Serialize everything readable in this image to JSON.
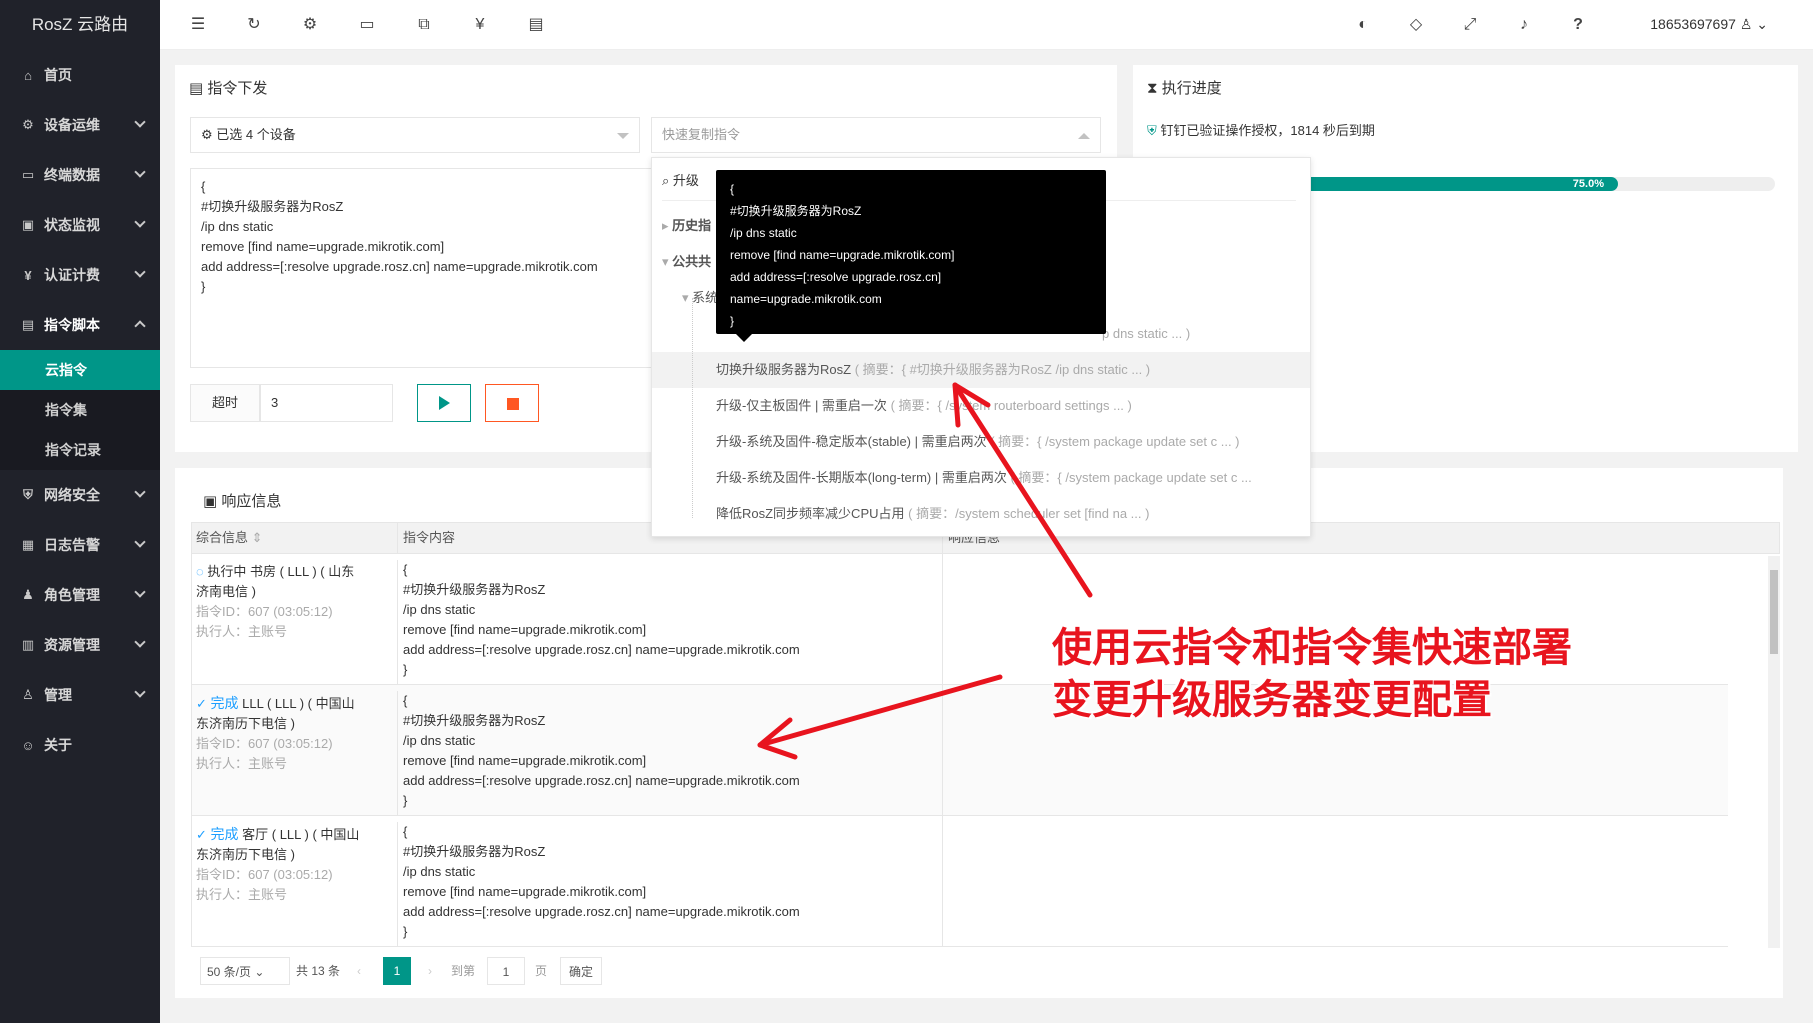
{
  "app": {
    "logo": "RosZ 云路由",
    "user": "18653697697"
  },
  "sidebar": {
    "items": [
      {
        "label": "首页",
        "icon": "home-icon"
      },
      {
        "label": "设备运维",
        "icon": "device-icon"
      },
      {
        "label": "终端数据",
        "icon": "terminal-icon"
      },
      {
        "label": "状态监视",
        "icon": "monitor-icon"
      },
      {
        "label": "认证计费",
        "icon": "billing-icon"
      },
      {
        "label": "指令脚本",
        "icon": "script-icon"
      },
      {
        "label": "网络安全",
        "icon": "shield-icon"
      },
      {
        "label": "日志告警",
        "icon": "log-icon"
      },
      {
        "label": "角色管理",
        "icon": "role-icon"
      },
      {
        "label": "资源管理",
        "icon": "resource-icon"
      },
      {
        "label": "管理",
        "icon": "admin-icon"
      },
      {
        "label": "关于",
        "icon": "about-icon"
      }
    ],
    "sub": [
      "云指令",
      "指令集",
      "指令记录"
    ]
  },
  "command": {
    "title": "指令下发",
    "device_select": "已选 4 个设备",
    "quick_placeholder": "快速复制指令",
    "script": "{\n#切换升级服务器为RosZ\n/ip dns static\nremove [find name=upgrade.mikrotik.com]\nadd address=[:resolve upgrade.rosz.cn] name=upgrade.mikrotik.com\n}",
    "timeout_label": "超时",
    "timeout_value": "3"
  },
  "dropdown": {
    "search_value": "升级",
    "group_history": "历史指",
    "group_public": "公共共",
    "group_sys": "系统",
    "first_partial": "p dns static ... )",
    "items": [
      {
        "name": "切换升级服务器为RosZ",
        "sum": "( 摘要：{ #切换升级服务器为RosZ /ip dns static ... )"
      },
      {
        "name": "升级-仅主板固件 | 需重启一次",
        "sum": "( 摘要：{ /system routerboard settings ... )"
      },
      {
        "name": "升级-系统及固件-稳定版本(stable) | 需重启两次",
        "sum": "( 摘要：{ /system package update set c ... )"
      },
      {
        "name": "升级-系统及固件-长期版本(long-term) | 需重启两次",
        "sum": "( 摘要：{ /system package update set c ..."
      },
      {
        "name": "降低RosZ同步频率减少CPU占用",
        "sum": "( 摘要：/system scheduler set [find na ... )"
      }
    ]
  },
  "tooltip": "{\n#切换升级服务器为RosZ\n/ip dns static\nremove [find name=upgrade.mikrotik.com]\nadd address=[:resolve upgrade.rosz.cn]\nname=upgrade.mikrotik.com\n}",
  "progress": {
    "title": "执行进度",
    "auth": "钉钉已验证操作授权，1814 秒后到期",
    "percent": 75.0,
    "percent_label": "75.0%"
  },
  "response": {
    "title": "响应信息",
    "headers": [
      "综合信息",
      "指令内容",
      "响应信息"
    ],
    "rows": [
      {
        "status": "执行中",
        "line1": " 书房 ( LLL ) ( 山东",
        "line2": "济南电信 )",
        "id": "指令ID：607 (03:05:12)",
        "exec": "执行人：主账号"
      },
      {
        "status": "完成",
        "line1": " LLL ( LLL ) ( 中国山",
        "line2": "东济南历下电信 )",
        "id": "指令ID：607 (03:05:12)",
        "exec": "执行人：主账号"
      },
      {
        "status": "完成",
        "line1": " 客厅 ( LLL ) ( 中国山",
        "line2": "东济南历下电信 )",
        "id": "指令ID：607 (03:05:12)",
        "exec": "执行人：主账号"
      }
    ],
    "script": "{\n#切换升级服务器为RosZ\n/ip dns static\nremove [find name=upgrade.mikrotik.com]\nadd address=[:resolve upgrade.rosz.cn] name=upgrade.mikrotik.com\n}"
  },
  "pager": {
    "per_page": "50 条/页",
    "total": "共 13 条",
    "page": "1",
    "goto": "到第",
    "goto_value": "1",
    "page_unit": "页",
    "confirm": "确定"
  },
  "annotation": {
    "line1": "使用云指令和指令集快速部署",
    "line2": "变更升级服务器变更配置",
    "color": "#e8141e"
  }
}
